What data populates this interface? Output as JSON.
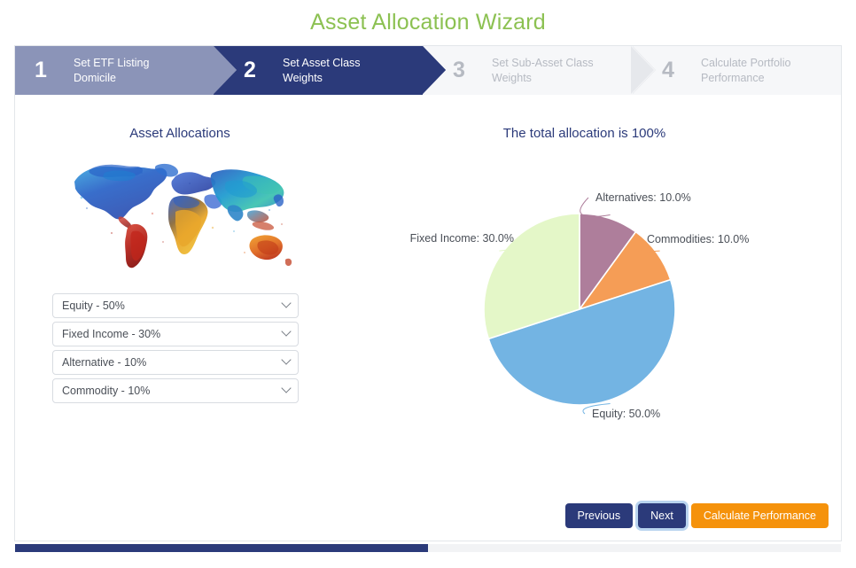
{
  "page": {
    "title": "Asset Allocation Wizard",
    "title_color": "#8CC152"
  },
  "wizard": {
    "steps": [
      {
        "number": "1",
        "label_line1": "Set ETF Listing",
        "label_line2": "Domicile",
        "state": "completed",
        "bg": "#8b94b8"
      },
      {
        "number": "2",
        "label_line1": "Set Asset Class",
        "label_line2": "Weights",
        "state": "active",
        "bg": "#2b3a7a"
      },
      {
        "number": "3",
        "label_line1": "Set Sub-Asset Class",
        "label_line2": "Weights",
        "state": "upcoming",
        "bg": "#f6f7f9"
      },
      {
        "number": "4",
        "label_line1": "Calculate Portfolio",
        "label_line2": "Performance",
        "state": "upcoming",
        "bg": "#f6f7f9"
      }
    ]
  },
  "left_panel": {
    "title": "Asset Allocations",
    "map_icon": "world-map-watercolor",
    "selects": [
      {
        "name": "equity",
        "value": "Equity - 50%"
      },
      {
        "name": "fixed-income",
        "value": "Fixed Income - 30%"
      },
      {
        "name": "alternative",
        "value": "Alternative - 10%"
      },
      {
        "name": "commodity",
        "value": "Commodity - 10%"
      }
    ]
  },
  "right_panel": {
    "title": "The total allocation is 100%"
  },
  "chart_data": {
    "type": "pie",
    "title": "The total allocation is 100%",
    "start_angle_deg": 0,
    "direction": "clockwise",
    "total_label": "100%",
    "labels": [
      "Alternatives",
      "Commodities",
      "Equity",
      "Fixed Income"
    ],
    "values": [
      10.0,
      10.0,
      50.0,
      30.0
    ],
    "value_labels": [
      "Alternatives: 10.0%",
      "Commodities: 10.0%",
      "Equity: 50.0%",
      "Fixed Income: 30.0%"
    ],
    "colors": [
      "#ae7e9b",
      "#f59d56",
      "#73b4e3",
      "#e4f7c8"
    ],
    "label_positions": [
      "top-right",
      "right",
      "bottom",
      "left"
    ],
    "legend": "none",
    "grid": false
  },
  "buttons": {
    "previous": "Previous",
    "next": "Next",
    "calculate": "Calculate Performance",
    "navy": "#2b3a7a",
    "orange": "#f5920b"
  },
  "scrollbar": {
    "thumb_percent": "50"
  }
}
